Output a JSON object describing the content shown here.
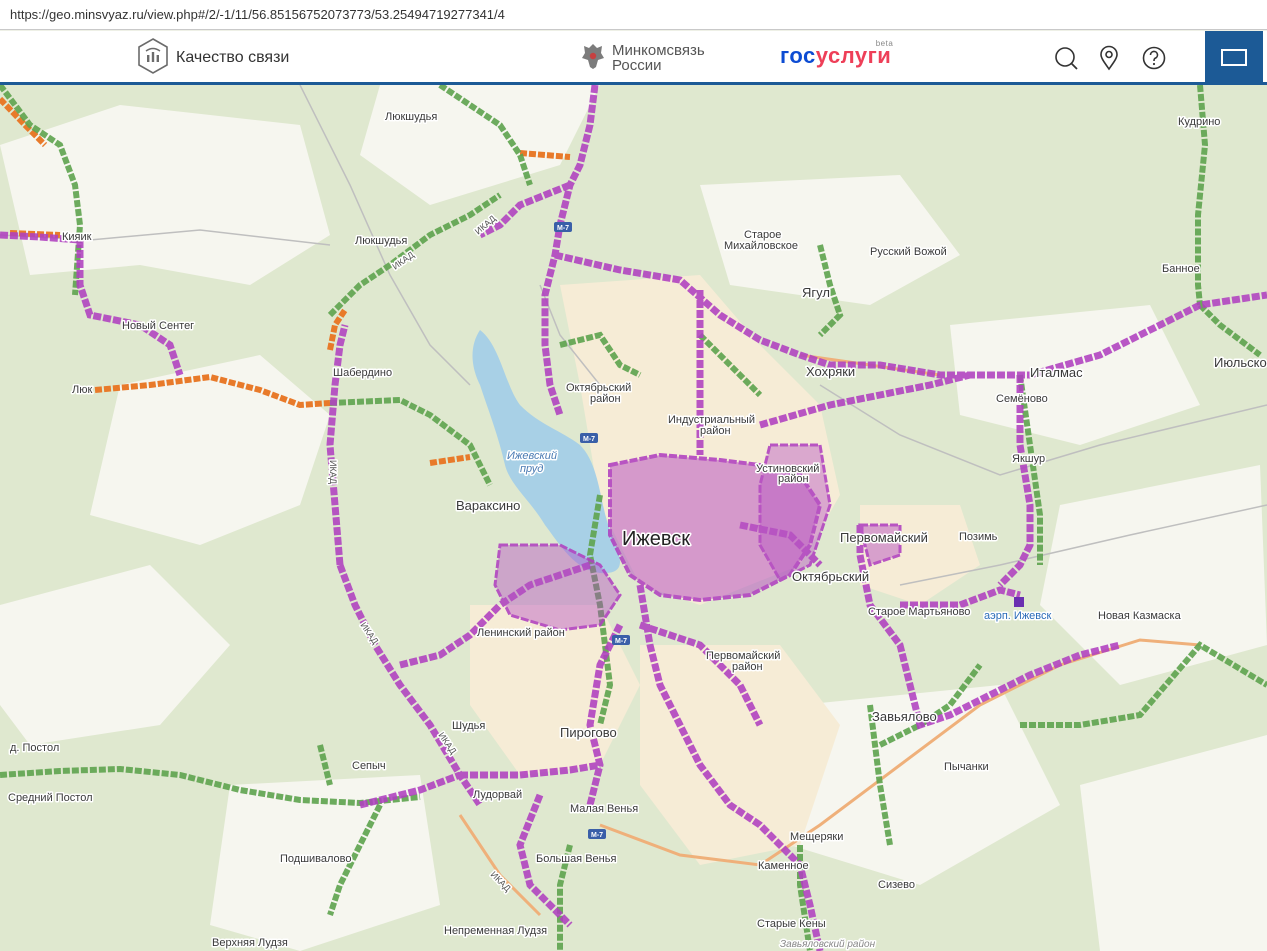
{
  "browser": {
    "url": "https://geo.minsvyaz.ru/view.php#/2/-1/11/56.85156752073773/53.25494719277341/4"
  },
  "header": {
    "service_name": "Качество связи",
    "ministry_line1": "Минкомсвязь",
    "ministry_line2": "России",
    "gosuslugi_part1": "гос",
    "gosuslugi_part2": "услуги",
    "gosuslugi_beta": "beta",
    "colors": {
      "gos": "#0d4cd3",
      "uslugi": "#ee3f58",
      "accent": "#1c5a96"
    },
    "icons": [
      "signal-quality-icon",
      "search-icon",
      "location-pin-icon",
      "help-icon",
      "panel-toggle-icon"
    ]
  },
  "map": {
    "coverage_colors": {
      "high": "#b040c0",
      "medium": "#5ea34e",
      "low": "#e87a2a"
    },
    "labels": {
      "izhevsk": "Ижевск",
      "izhevsky_prud_1": "Ижевский",
      "izhevsky_prud_2": "пруд",
      "lyukshudya_n": "Люкшудья",
      "lyukshudya": "Люкшудья",
      "kiyaik": "Кияик",
      "novy_sentег": "Новый Сентег",
      "shaberdino": "Шабердино",
      "lyuk": "Люк",
      "oktyabrsky_r1": "Октябрьский",
      "oktyabrsky_r2": "район",
      "industrialny_r1": "Индустриальный",
      "industrialny_r2": "район",
      "ustinovsky_r1": "Устиновский",
      "ustinovsky_r2": "район",
      "varaksino": "Вараксино",
      "leninsky_r": "Ленинский район",
      "pervomaysky_r1": "Первомайский",
      "pervomaysky_r2": "район",
      "pervomaysky": "Первомайский",
      "oktyabrsky": "Октябрьский",
      "pozim": "Позимь",
      "staroe_mikh1": "Старое",
      "staroe_mikh2": "Михайловское",
      "russky_vozhoy": "Русский Вожой",
      "yagul": "Ягул",
      "khokhryaki": "Хохряки",
      "italmas": "Италмас",
      "semenovo": "Семёново",
      "yakshur": "Якшур",
      "kudrino": "Кудрино",
      "bannoe": "Банное",
      "iyulskoe": "Июльское",
      "staroe_martyanovo": "Старое Мартьяново",
      "aerp_izhevsk": "аэрп. Ижевск",
      "novaya_kazmaska": "Новая Казмаска",
      "zavyalovo": "Завьялово",
      "pychanki": "Пычанки",
      "meshcheryaki": "Мещеряки",
      "kamennoe": "Каменное",
      "sizevo": "Сизево",
      "starye_keny": "Старые Кены",
      "zavyalovsky_r": "Завьяловский район",
      "pirogovo": "Пирогово",
      "shudya": "Шудья",
      "sepych": "Сепыч",
      "ludorvay": "Лудорвай",
      "malaya_venya": "Малая Венья",
      "bolshaya_venya": "Большая Венья",
      "podshivalovo": "Подшивалово",
      "nepremennaya_ludzya": "Непременная Лудзя",
      "verkhnyaya_ludzya": "Верхняя Лудзя",
      "d_postol": "д. Постол",
      "sredny_postol": "Средний Постол",
      "ikad": "ИКАД",
      "m7": "М-7"
    }
  }
}
